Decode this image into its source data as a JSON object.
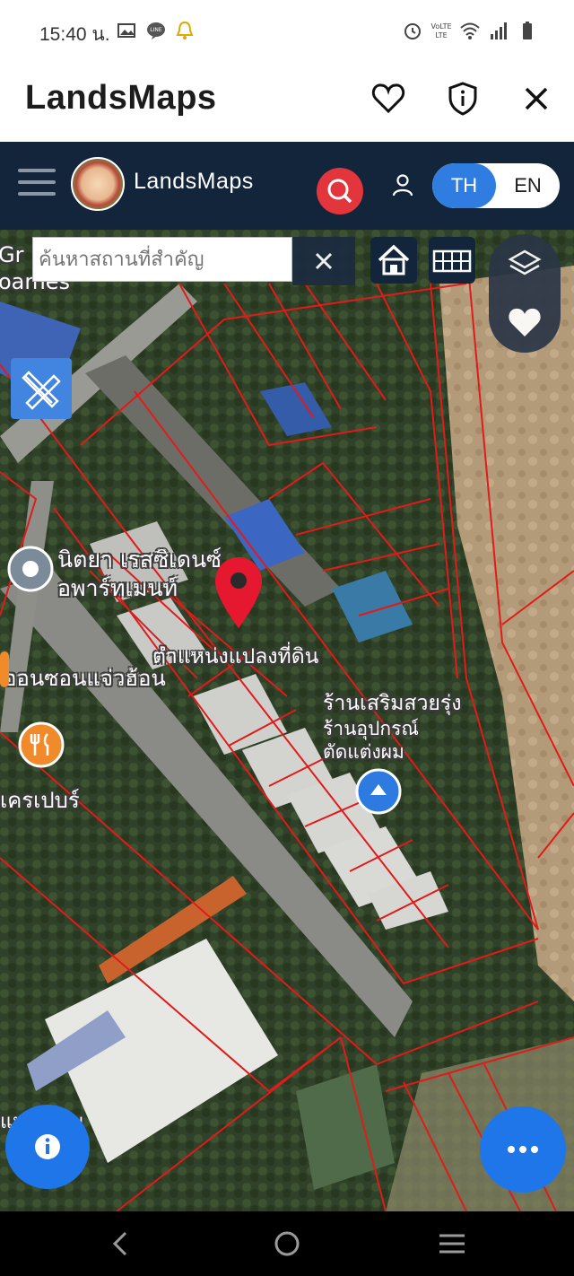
{
  "status_bar": {
    "time": "15:40 น.",
    "left_icons": [
      "gallery-notification-icon",
      "line-notification-icon",
      "bell-notification-icon"
    ],
    "right_icons": [
      "alarm-icon",
      "volte-icon",
      "wifi-icon",
      "signal-icon",
      "battery-icon"
    ]
  },
  "app_header": {
    "title": "LandsMaps",
    "icons": [
      "heart-icon",
      "shield-icon",
      "close-icon"
    ]
  },
  "navbar": {
    "brand": "LandsMaps",
    "languages": [
      {
        "label": "TH",
        "active": true
      },
      {
        "label": "EN",
        "active": false
      }
    ],
    "accent_color": "#2f7de1",
    "search_color": "#e3353c",
    "background_color": "#13253b"
  },
  "map": {
    "search_placeholder": "ค้นหาสถานที่สำคัญ",
    "labels": {
      "top_left_1": "Gr",
      "top_left_2": "oames",
      "residence_1": "นิตยา เรสซิเดนซ์",
      "residence_2": "อพาร์ทเมนท์",
      "parcel": "ตำแหน่งแปลงที่ดิน",
      "onsorn": "ออนซอนแจ่วฮ้อน",
      "beauty_1": "ร้านเสริมสวยรุ่ง",
      "beauty_2": "ร้านอุปกรณ์",
      "beauty_3": "ตัดแต่งผม",
      "crepe": "เครเปบร์",
      "bottom": "แหล่งขาย"
    },
    "parcel_line_color": "#e01b1b",
    "pin_color": "#e5182f"
  },
  "fab": {
    "info_icon": "info-icon",
    "more_icon": "more-dots-icon",
    "color": "#1f76e8"
  },
  "system_nav": [
    "back-icon",
    "home-icon",
    "recents-icon"
  ]
}
